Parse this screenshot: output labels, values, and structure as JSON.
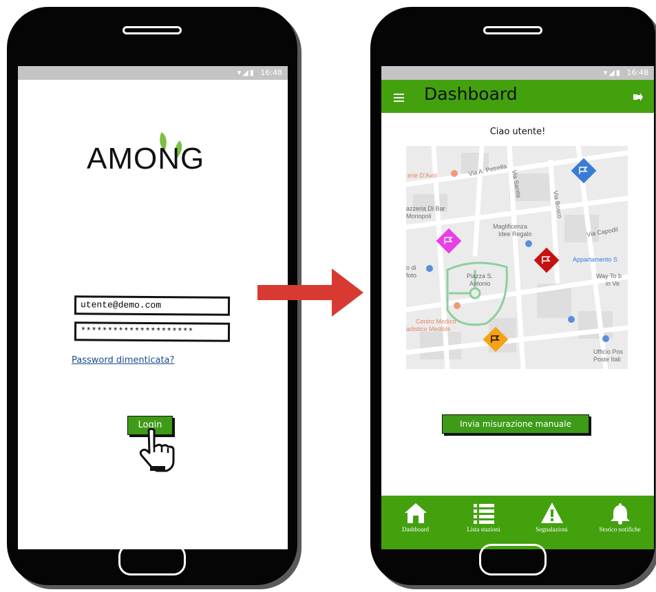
{
  "login": {
    "status_time": "16:48",
    "logo_text": "AMONG",
    "email_value": "utente@demo.com",
    "password_value": "*********************",
    "forgot_password_label": "Password dimenticata?",
    "login_label": "Login"
  },
  "dashboard": {
    "status_time": "16:48",
    "title": "Dashboard",
    "greeting": "Ciao utente!",
    "map_labels": [
      "erie D'Avol",
      "Via A. Petrella",
      "Via Sanita",
      "Via Bosco",
      "azzeria Di Bar",
      "Monopoli",
      "Maglificenza",
      "Idee Regalo",
      "Via Capodil",
      "o di",
      "foto",
      "Piazza S.",
      "Antonio",
      "Appartamento S",
      "Way To b",
      "in Ve",
      "Centro Medico",
      "adistico Medible",
      "Ufficio Pos",
      "Poste Itali"
    ],
    "manual_button_label": "Invia misurazione manuale",
    "nav": [
      {
        "label": "Dashboard",
        "icon": "home-icon"
      },
      {
        "label": "Lista stazioni",
        "icon": "list-icon"
      },
      {
        "label": "Segnalazioni",
        "icon": "warning-icon"
      },
      {
        "label": "Storico notifiche",
        "icon": "bell-icon"
      }
    ],
    "marker_colors": {
      "blue": "#3a7bd5",
      "magenta": "#e83ee8",
      "red": "#c41212",
      "orange": "#f7a213"
    }
  },
  "colors": {
    "accent_green": "#43a10e",
    "button_green": "#3e9b17",
    "arrow_red": "#d83a31"
  }
}
